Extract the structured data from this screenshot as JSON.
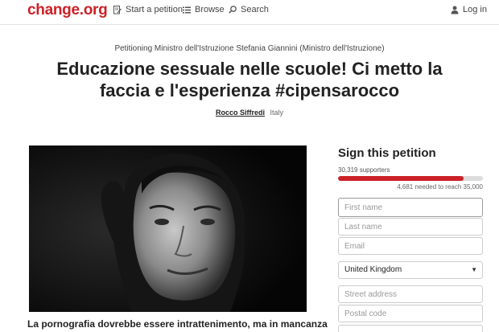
{
  "header": {
    "logo": {
      "main": "change",
      "suffix": ".org"
    },
    "nav": {
      "start_petition": "Start a petition",
      "browse": "Browse",
      "search": "Search",
      "login": "Log in"
    },
    "icons": {
      "start": "document-edit-icon",
      "browse": "list-icon",
      "search": "search-icon",
      "login": "user-icon"
    }
  },
  "petition": {
    "petitioning": "Petitioning Ministro dell'Istruzione Stefania Giannini (Ministro dell'Istruzione)",
    "title": "Educazione sessuale nelle scuole! Ci metto la faccia e l'esperienza #cipensarocco",
    "author": "Rocco Siffredi",
    "country": "Italy",
    "body_start": "La pornografia dovrebbe essere intrattenimento, ma in mancanza"
  },
  "sign": {
    "title": "Sign this petition",
    "supporters": "30,319 supporters",
    "goal_text": "4,681 needed to reach 35,000",
    "progress_fraction": 0.866,
    "fields": {
      "first_name": "First name",
      "last_name": "Last name",
      "email": "Email",
      "country": "United Kingdom",
      "street": "Street address",
      "postal": "Postal code"
    }
  },
  "colors": {
    "brand": "#cc2127",
    "progress_track": "#dcdcdc"
  }
}
